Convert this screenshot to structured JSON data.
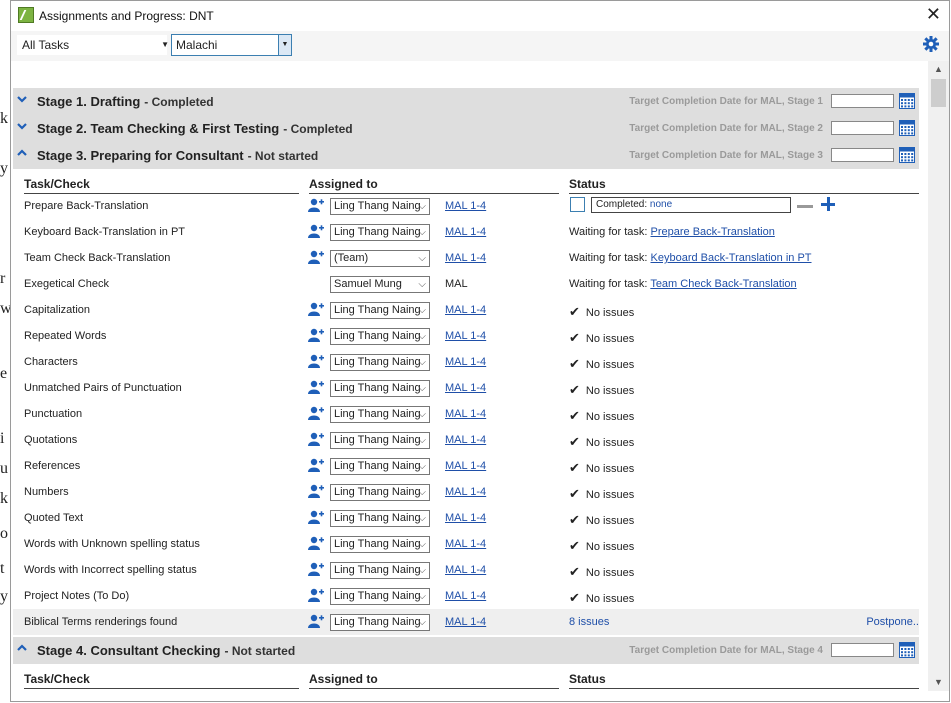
{
  "window": {
    "title": "Assignments and Progress: DNT",
    "close_label": "✕"
  },
  "toolbar": {
    "task_filter": "All Tasks",
    "book": "Malachi"
  },
  "columns": {
    "task": "Task/Check",
    "assigned": "Assigned to",
    "status": "Status"
  },
  "stages": [
    {
      "title": "Stage 1. Drafting",
      "status": "- Completed",
      "target": "Target Completion Date for MAL, Stage 1",
      "expanded": false
    },
    {
      "title": "Stage 2. Team Checking & First Testing",
      "status": "- Completed",
      "target": "Target Completion Date for MAL, Stage 2",
      "expanded": false
    },
    {
      "title": "Stage 3. Preparing for Consultant",
      "status": "- Not started",
      "target": "Target Completion Date for MAL, Stage 3",
      "expanded": true
    },
    {
      "title": "Stage 4. Consultant Checking",
      "status": "- Not started",
      "target": "Target Completion Date for MAL, Stage 4",
      "expanded": true
    }
  ],
  "tasks": [
    {
      "name": "Prepare Back-Translation",
      "assignee": "Ling Thang Naing",
      "ref": "MAL 1-4",
      "status_prefix": "",
      "status_link": ""
    },
    {
      "name": "Keyboard Back-Translation in PT",
      "assignee": "Ling Thang Naing",
      "ref": "MAL 1-4",
      "status_prefix": "Waiting for task: ",
      "status_link": "Prepare Back-Translation"
    },
    {
      "name": "Team Check Back-Translation",
      "assignee": "(Team)",
      "ref": "MAL 1-4",
      "status_prefix": "Waiting for task: ",
      "status_link": "Keyboard Back-Translation in PT"
    },
    {
      "name": "Exegetical Check",
      "assignee": "Samuel Mung",
      "ref": "MAL",
      "status_prefix": "Waiting for task: ",
      "status_link": "Team Check Back-Translation"
    },
    {
      "name": "Capitalization",
      "assignee": "Ling Thang Naing",
      "ref": "MAL 1-4",
      "status": "No issues"
    },
    {
      "name": "Repeated Words",
      "assignee": "Ling Thang Naing",
      "ref": "MAL 1-4",
      "status": "No issues"
    },
    {
      "name": "Characters",
      "assignee": "Ling Thang Naing",
      "ref": "MAL 1-4",
      "status": "No issues"
    },
    {
      "name": "Unmatched Pairs of Punctuation",
      "assignee": "Ling Thang Naing",
      "ref": "MAL 1-4",
      "status": "No issues"
    },
    {
      "name": "Punctuation",
      "assignee": "Ling Thang Naing",
      "ref": "MAL 1-4",
      "status": "No issues"
    },
    {
      "name": "Quotations",
      "assignee": "Ling Thang Naing",
      "ref": "MAL 1-4",
      "status": "No issues"
    },
    {
      "name": "References",
      "assignee": "Ling Thang Naing",
      "ref": "MAL 1-4",
      "status": "No issues"
    },
    {
      "name": "Numbers",
      "assignee": "Ling Thang Naing",
      "ref": "MAL 1-4",
      "status": "No issues"
    },
    {
      "name": "Quoted Text",
      "assignee": "Ling Thang Naing",
      "ref": "MAL 1-4",
      "status": "No issues"
    },
    {
      "name": "Words with Unknown spelling status",
      "assignee": "Ling Thang Naing",
      "ref": "MAL 1-4",
      "status": "No issues"
    },
    {
      "name": "Words with Incorrect spelling status",
      "assignee": "Ling Thang Naing",
      "ref": "MAL 1-4",
      "status": "No issues"
    },
    {
      "name": "Project Notes (To Do)",
      "assignee": "Ling Thang Naing",
      "ref": "MAL 1-4",
      "status": "No issues"
    },
    {
      "name": "Biblical Terms renderings found",
      "assignee": "Ling Thang Naing",
      "ref": "MAL 1-4",
      "issues": "8 issues",
      "postpone": "Postpone..."
    }
  ],
  "completed": {
    "label": "Completed: ",
    "value": "none"
  },
  "colors": {
    "link": "#1f4fa8",
    "accent": "#1f5fb8",
    "stage_bg": "#dedede"
  },
  "icons": [
    "app-icon",
    "settings-gear-icon",
    "chevron-down-icon",
    "chevron-up-icon",
    "calendar-icon",
    "assign-user-icon",
    "checkmark-icon",
    "plus-icon",
    "minus-icon"
  ]
}
